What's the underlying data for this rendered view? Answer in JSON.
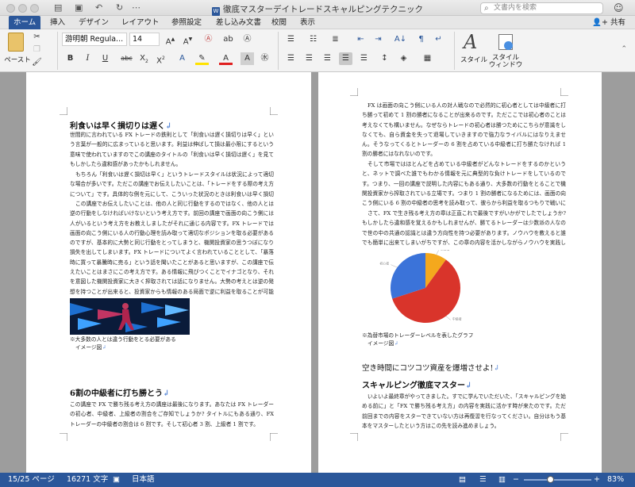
{
  "window": {
    "title": "徹底マスターデイトレードスキャルピングテクニック",
    "search_placeholder": "文書内を検索"
  },
  "tabs": [
    "ホーム",
    "挿入",
    "デザイン",
    "レイアウト",
    "参照設定",
    "差し込み文書",
    "校閲",
    "表示"
  ],
  "share_label": "共有",
  "ribbon": {
    "paste_label": "ペースト",
    "font_name": "游明朝 Regula...",
    "font_size": "14",
    "styles_label": "スタイル",
    "styles_pane_label_1": "スタイル",
    "styles_pane_label_2": "ウィンドウ"
  },
  "left_page": {
    "heading1": "利食いは早く損切りは遅く",
    "para1": "世間的に言われている FX トレードの鉄則として「利食いは遅く損切りは早く」という言葉が一般的に広まっていると思います。利益は伸ばして損は最小限にするという意味で使われていますのでこの講座のタイトルの「利食いは早く損切は遅く」を見てもしかしたら違和感があったかもしれません。",
    "para2": "もちろん「利食いは遅く損切は早く」というトレードスタイルは状況によって適切な場合が多いです。ただこの講座でお伝えしたいことは、「トレードをする際の考え方について」です。具体的な例を元にして、こういった状況のときは利食いは早く損切りは遅くしようというお話ではありません。",
    "para3": "この講座でお伝えしたいことは、他の人と同じ行動をするのではなく、他の人とは逆の行動をしなければいけないという考え方です。前回の講座で画面の向こう側には人がいるという考え方をお教えしましたがそれに通じる内容です。FX トレードでは画面の向こう側にいる人の行動心理を読み取って適切なポジションを取る必要があるのですが、基本的に大勢と同じ行動をとってしまうと、機関投資家の思うつぼになり損失を出してしまいます。FX トレードについてよく言われていることとして、「暴落時に買って暴騰時に売る」という話を聞いたことがあると思いますが、この講座で伝えたいことはまさにこの考え方です。ある情報に飛びつくことでイナゴとなり、それを意図した機関投資家に大きく搾取されては話になりません。大勢の考えとは逆の発想を持つことが出来ると、投資家からも情報のある局面で逆に利益を取ることが可能になるのです。周りに流されず逆をいくという考え方もこれから意識していきましょう。",
    "caption1": "※大多数の人とは違う行動をとる必要がある",
    "caption2": "イメージ図",
    "heading2": "6割の中級者に打ち勝とう",
    "para4": "この講座で FX で勝ち残る考え方の講座は最後になります。あなたは FX トレーダーの初心者、中級者、上級者の割合をご存知でしょうか? タイトルにもある通り、FX トレーダーの中級者の割合は 6 割です。そして初心者 3 割、上級者 1 割です。"
  },
  "right_page": {
    "para1": "FX は画面の向こう側にいる人の対人戦なので必然的に初心者としては中級者に打ち勝って初めて 1 割の勝者になることが出来るのです。ただここでは初心者のことは考えなくても構いません。なぜならトレードの初心者は勝つためにこちらが意識をしなくても、自ら資金を失って退場していきますので強力なライバルにはなりえません。そうなってくるとトレーダーの 6 割を占めている中級者に打ち勝たなければ 1 割の勝者にはなれないのです。",
    "para2": "そして市場ではほとんどを占めている中級者がどんなトレードをするのかというと、ネットで調べた誰でもわかる情報を元に典型的な負けトレードをしているのです。つまり、一回の講座で説明した内容にもある通り、大多数の行動をとることで機関投資家から搾取されている立場です。つまり 1 割の勝者になるためには、画面の向こう側にいる 6 割の中級者の思考を読み取って、彼らから利益を取るつもりで戦いに挑まなくてはなりません。そのために次の章から具体的なトレード手法についてお教えしていきます。",
    "para3": "さて、FX で生き残る考え方の章は正直これで最後ですがいかがでしたでしょうか?もしかしたら違和感を覚えるかもしれませんが、勝てるトレーダーは少数派の人なので世の中の共通の認識とは違う方向性を持つ必要があります。ノウハウを教えると誰でも簡単に出来てしまいがちですが、この章の内容を活かしながらノウハウを実践していきましょう。",
    "caption1": "※為替市場のトレーダーレベルを表したグラフ",
    "caption2": "イメージ図",
    "heading1": "空き時間にコツコツ資産を爆増させよ!",
    "heading2": "スキャルピング徹底マスター",
    "para4": "いよいよ最終章がやってきました。すでに学んでいただいた、「スキャルピングを始める前に」と「FX で勝ち残る考え方」の内容を実践に活かす時が来たのです。ただ前回までの内容をスターできていない方は再復習を行なってください。自分はもう基本をマスターしたという方はこの先を読み進めましょう。"
  },
  "chart_data": {
    "type": "pie",
    "categories": [
      "上級者",
      "中級者",
      "初心者"
    ],
    "values": [
      10,
      60,
      30
    ],
    "colors": [
      "#f4a81d",
      "#d9342b",
      "#3b73d9"
    ]
  },
  "statusbar": {
    "page": "15/25 ページ",
    "words": "16271 文字",
    "language": "日本語",
    "zoom_label": "83%",
    "zoom_value": 0.83
  }
}
